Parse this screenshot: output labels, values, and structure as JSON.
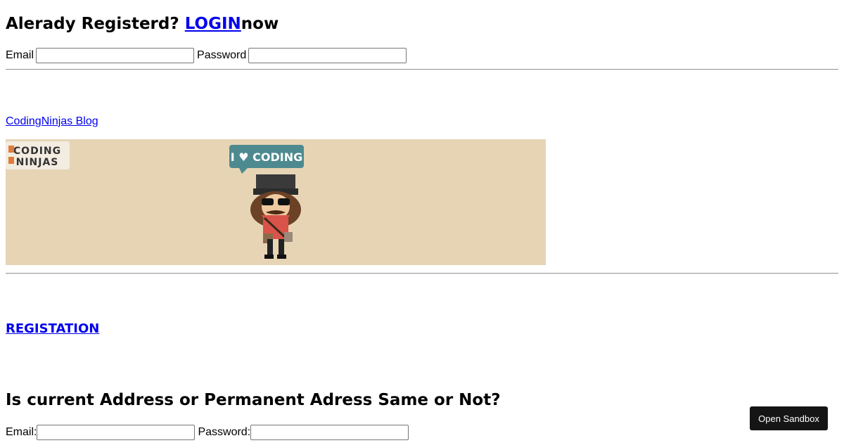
{
  "login": {
    "heading_prefix": "Alerady Registerd? ",
    "link_label": "LOGIN",
    "heading_suffix": "now",
    "email_label": "Email",
    "email_value": "",
    "password_label": "Password",
    "password_value": ""
  },
  "blog": {
    "link_label": "CodingNinjas Blog",
    "banner": {
      "logo_text_top": "CODING",
      "logo_text_bottom": "NINJAS",
      "bubble_text": "I ♥ CODING",
      "colors": {
        "background": "#e6d4b5",
        "bubble": "#4d8a8f",
        "shirt": "#d9534a"
      }
    }
  },
  "registration": {
    "link_label": "REGISTATION"
  },
  "address": {
    "heading": "Is current Address or Permanent Adress Same or Not?",
    "email_label": "Email:",
    "email_value": "",
    "password_label": "Password:",
    "password_value": ""
  },
  "sandbox_button": {
    "label": "Open Sandbox"
  }
}
